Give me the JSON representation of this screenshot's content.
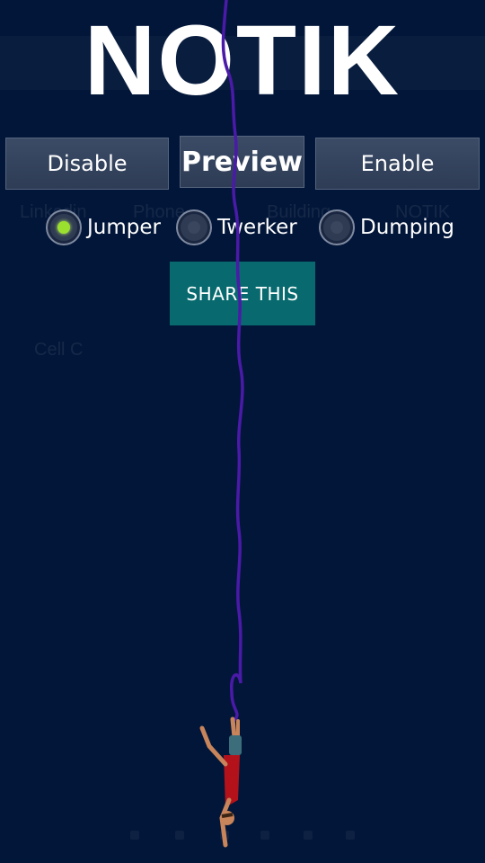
{
  "app": {
    "title": "NOTIK"
  },
  "buttons": {
    "disable": "Disable",
    "preview": "Preview",
    "enable": "Enable",
    "share": "SHARE THIS"
  },
  "modes": {
    "options": [
      "Jumper",
      "Twerker",
      "Dumping"
    ],
    "selected": "Jumper"
  },
  "background": {
    "labels": [
      "Linkedin",
      "Phone",
      "Building",
      "NOTIK",
      "Cell C"
    ]
  },
  "colors": {
    "background": "#021639",
    "rope": "#4a1aa8",
    "selected_radio": "#9be02f",
    "share_button": "#086a6e"
  },
  "icons": {
    "jumper_figure": "jumper-figure-icon"
  }
}
